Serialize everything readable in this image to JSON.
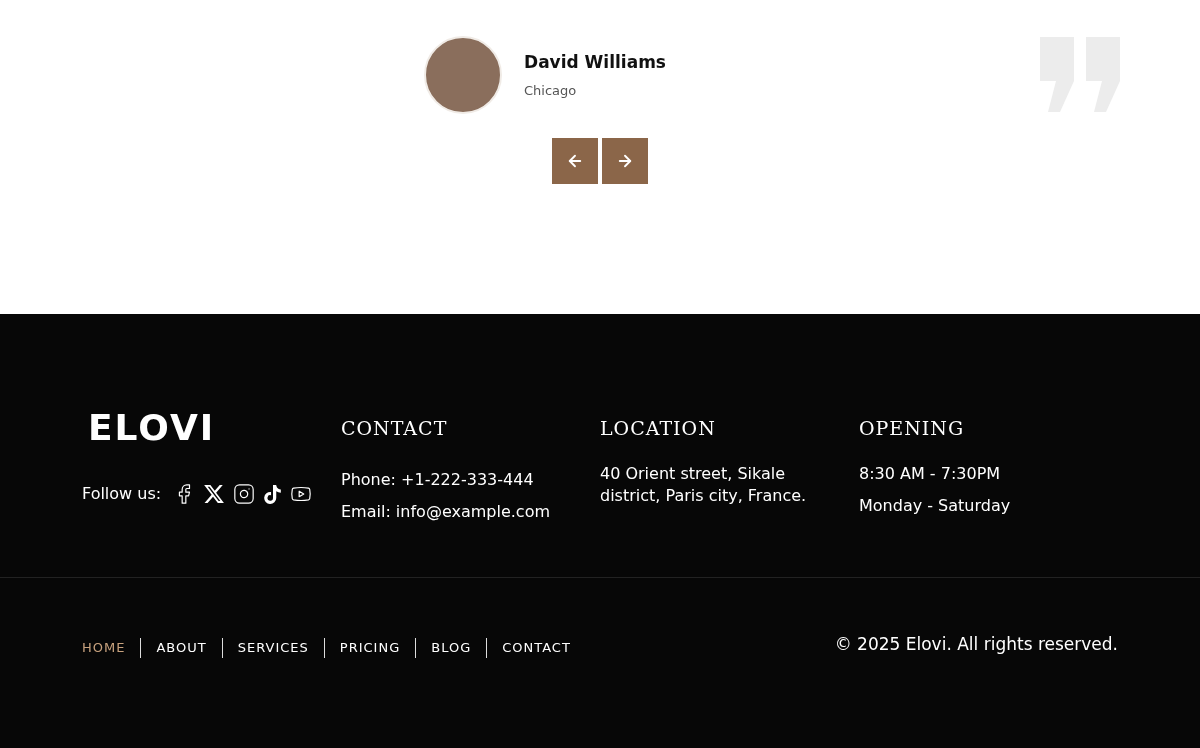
{
  "testimonial": {
    "name": "David Williams",
    "location": "Chicago"
  },
  "slider_controls": [
    {
      "kind": "prev"
    },
    {
      "kind": "next"
    }
  ],
  "footer": {
    "logo": "ELOVI",
    "follow_label": "Follow us:",
    "social": [
      {
        "kind": "facebook"
      },
      {
        "kind": "x"
      },
      {
        "kind": "instagram"
      },
      {
        "kind": "tiktok"
      },
      {
        "kind": "youtube"
      }
    ],
    "columns": [
      {
        "title": "CONTACT",
        "lines": [
          "Phone: +1-222-333-444",
          "Email: info@example.com"
        ]
      },
      {
        "title": "LOCATION",
        "lines": [
          "40 Orient street,  Sikale district, Paris city, France."
        ]
      },
      {
        "title": "OPENING",
        "lines": [
          "8:30 AM - 7:30PM",
          "Monday - Saturday"
        ]
      }
    ],
    "nav": [
      {
        "label": "HOME",
        "selected": true
      },
      {
        "label": "ABOUT",
        "selected": false
      },
      {
        "label": "SERVICES",
        "selected": false
      },
      {
        "label": "PRICING",
        "selected": false
      },
      {
        "label": "BLOG",
        "selected": false
      },
      {
        "label": "CONTACT",
        "selected": false
      }
    ],
    "copyright": "© 2025 Elovi. All rights reserved."
  }
}
